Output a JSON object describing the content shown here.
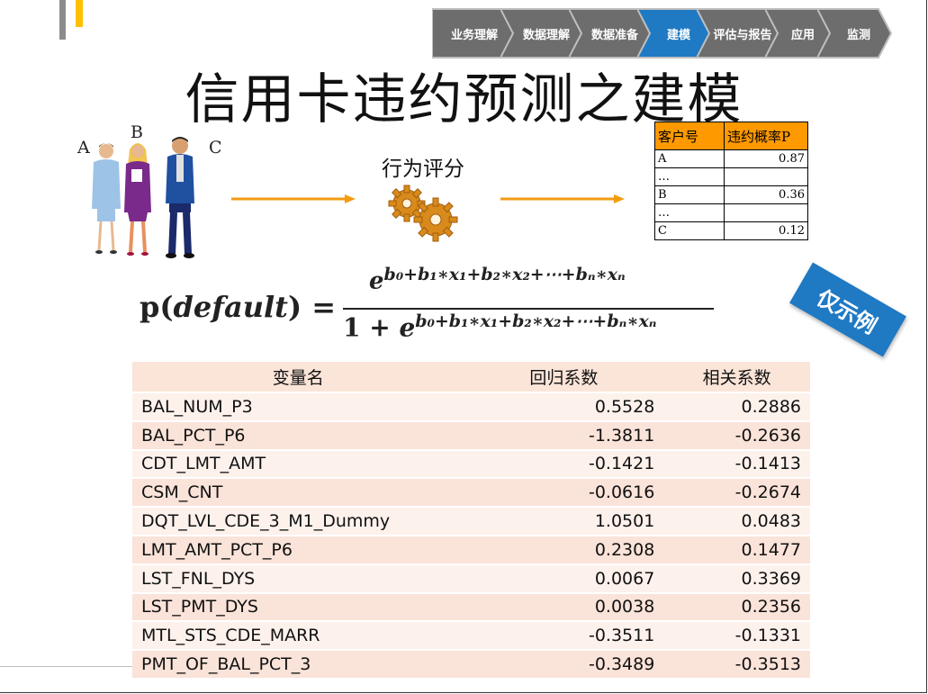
{
  "process_steps": [
    "业务理解",
    "数据理解",
    "数据准备",
    "建模",
    "评估与报告",
    "应用",
    "监测"
  ],
  "active_step": 3,
  "colors": {
    "step": "#6d6d6d",
    "active": "#1f79c3",
    "arrow": "#f39c12",
    "header": "#ff9900",
    "stamp": "#1f79c3"
  },
  "title": "信用卡违约预测之建模",
  "people_labels": [
    "A",
    "B",
    "C"
  ],
  "behavior_label": "行为评分",
  "prob_table": {
    "headers": [
      "客户号",
      "违约概率P"
    ],
    "rows": [
      [
        "A",
        "0.87"
      ],
      [
        "…",
        ""
      ],
      [
        "B",
        "0.36"
      ],
      [
        "…",
        ""
      ],
      [
        "C",
        "0.12"
      ]
    ]
  },
  "formula": {
    "lhs_p": "p",
    "lhs_arg": "default",
    "equals": "=",
    "e": "e",
    "exponent": "b₀+b₁∗x₁+b₂∗x₂+⋯+bₙ∗xₙ",
    "one_plus": "1 + "
  },
  "stamp": "仅示例",
  "coef_table": {
    "headers": [
      "变量名",
      "回归系数",
      "相关系数"
    ],
    "rows": [
      [
        "BAL_NUM_P3",
        "0.5528",
        "0.2886"
      ],
      [
        "BAL_PCT_P6",
        "-1.3811",
        "-0.2636"
      ],
      [
        "CDT_LMT_AMT",
        "-0.1421",
        "-0.1413"
      ],
      [
        "CSM_CNT",
        "-0.0616",
        "-0.2674"
      ],
      [
        "DQT_LVL_CDE_3_M1_Dummy",
        "1.0501",
        "0.0483"
      ],
      [
        "LMT_AMT_PCT_P6",
        "0.2308",
        "0.1477"
      ],
      [
        "LST_FNL_DYS",
        "0.0067",
        "0.3369"
      ],
      [
        "LST_PMT_DYS",
        "0.0038",
        "0.2356"
      ],
      [
        "MTL_STS_CDE_MARR",
        "-0.3511",
        "-0.1331"
      ],
      [
        "PMT_OF_BAL_PCT_3",
        "-0.3489",
        "-0.3513"
      ]
    ]
  }
}
